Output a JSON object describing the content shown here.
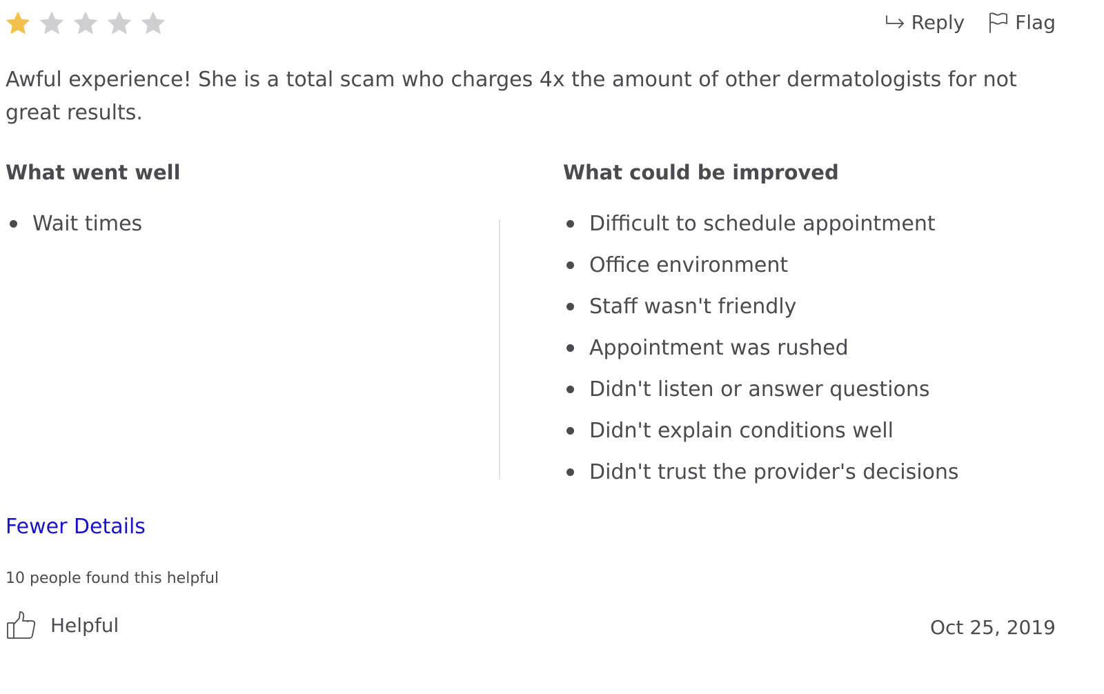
{
  "rating": {
    "value": 1,
    "max": 5,
    "filled_color": "#f2c04c",
    "empty_color": "#cfcfd3"
  },
  "actions": {
    "reply_label": "Reply",
    "reply_icon": "reply-arrow-icon",
    "flag_label": "Flag",
    "flag_icon": "flag-icon"
  },
  "review": {
    "text": "Awful experience! She is a total scam who charges 4x the amount of other dermatologists for not great results."
  },
  "went_well": {
    "heading": "What went well",
    "items": [
      "Wait times"
    ]
  },
  "could_improve": {
    "heading": "What could be improved",
    "items": [
      "Difficult to schedule appointment",
      "Office environment",
      "Staff wasn't friendly",
      "Appointment was rushed",
      "Didn't listen or answer questions",
      "Didn't explain conditions well",
      "Didn't trust the provider's decisions"
    ]
  },
  "details_link": {
    "label": "Fewer Details",
    "color": "#1a14c8"
  },
  "helpful": {
    "count_text": "10 people found this helpful",
    "button_label": "Helpful",
    "icon": "thumbs-up-icon"
  },
  "date": "Oct 25, 2019"
}
